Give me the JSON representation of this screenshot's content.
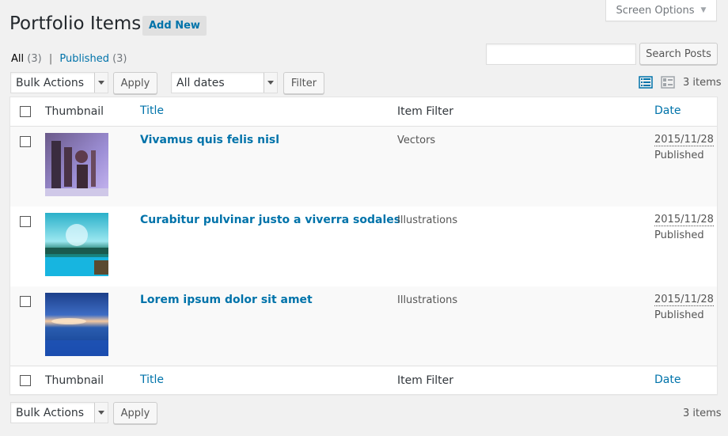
{
  "screen_options": {
    "label": "Screen Options"
  },
  "page": {
    "title": "Portfolio Items",
    "add_new": "Add New"
  },
  "views": {
    "all_label": "All",
    "all_count": "(3)",
    "separator": "|",
    "published_label": "Published",
    "published_count": "(3)"
  },
  "search": {
    "value": "",
    "button": "Search Posts"
  },
  "tablenav_top": {
    "bulk_actions": "Bulk Actions",
    "apply": "Apply",
    "dates": "All dates",
    "filter": "Filter",
    "items": "3 items"
  },
  "tablenav_bottom": {
    "bulk_actions": "Bulk Actions",
    "apply": "Apply",
    "items": "3 items"
  },
  "columns": {
    "thumbnail": "Thumbnail",
    "title": "Title",
    "item_filter": "Item Filter",
    "date": "Date"
  },
  "rows": [
    {
      "title": "Vivamus quis felis nisl",
      "item_filter": "Vectors",
      "date": "2015/11/28",
      "status": "Published",
      "thumb": "machinery-image"
    },
    {
      "title": "Curabitur pulvinar justo a viverra sodales",
      "item_filter": "Illustrations",
      "date": "2015/11/28",
      "status": "Published",
      "thumb": "lake-image"
    },
    {
      "title": "Lorem ipsum dolor sit amet",
      "item_filter": "Illustrations",
      "date": "2015/11/28",
      "status": "Published",
      "thumb": "ocean-sunset-image"
    }
  ],
  "colors": {
    "link": "#0073aa",
    "background": "#f1f1f1",
    "active_view_icon": "#0073aa"
  }
}
